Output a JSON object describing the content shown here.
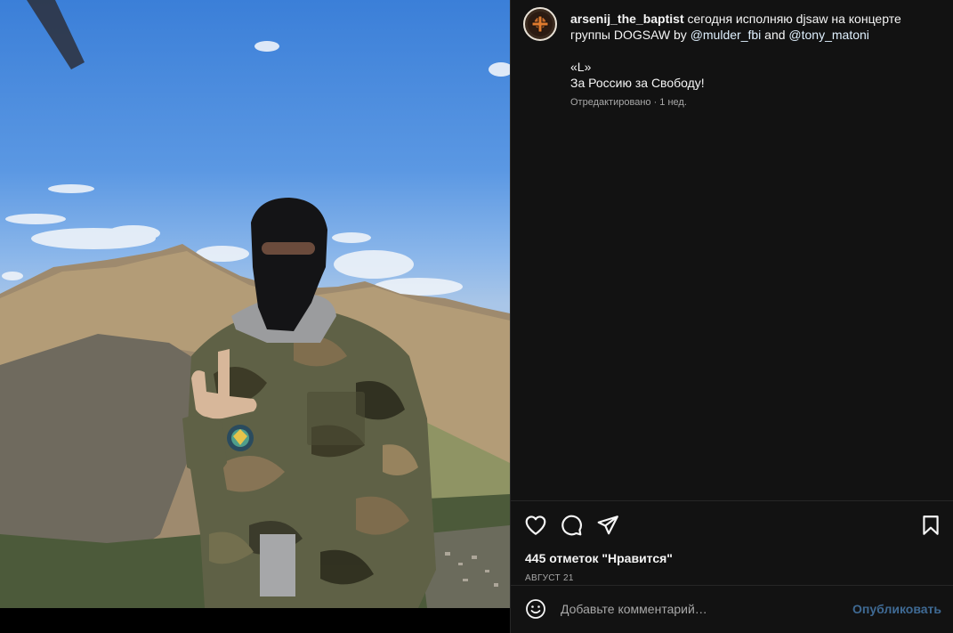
{
  "post": {
    "username": "arsenij_the_baptist",
    "caption_text": " сегодня исполняю djsaw на концерте группы DOGSAW by ",
    "mention_1": "@mulder_fbi",
    "and_text": " and ",
    "mention_2": "@tony_matoni",
    "caption_line_1": "«L»",
    "caption_line_2": "За Россию за Свободу!",
    "meta": "Отредактировано · 1 нед."
  },
  "actions": {
    "likes": "445 отметок \"Нравится\"",
    "date": "АВГУСТ 21"
  },
  "comment_box": {
    "placeholder": "Добавьте комментарий…",
    "publish_label": "Опубликовать"
  },
  "icons": {
    "like": "heart-icon",
    "comment": "comment-bubble-icon",
    "share": "paper-plane-icon",
    "save": "bookmark-icon",
    "emoji": "smiley-icon"
  },
  "colors": {
    "panel_bg": "#121212",
    "text": "#f5f5f5",
    "secondary_text": "#a8a8a8",
    "mention": "#e0f1ff",
    "publish_disabled": "#3f6a94"
  }
}
